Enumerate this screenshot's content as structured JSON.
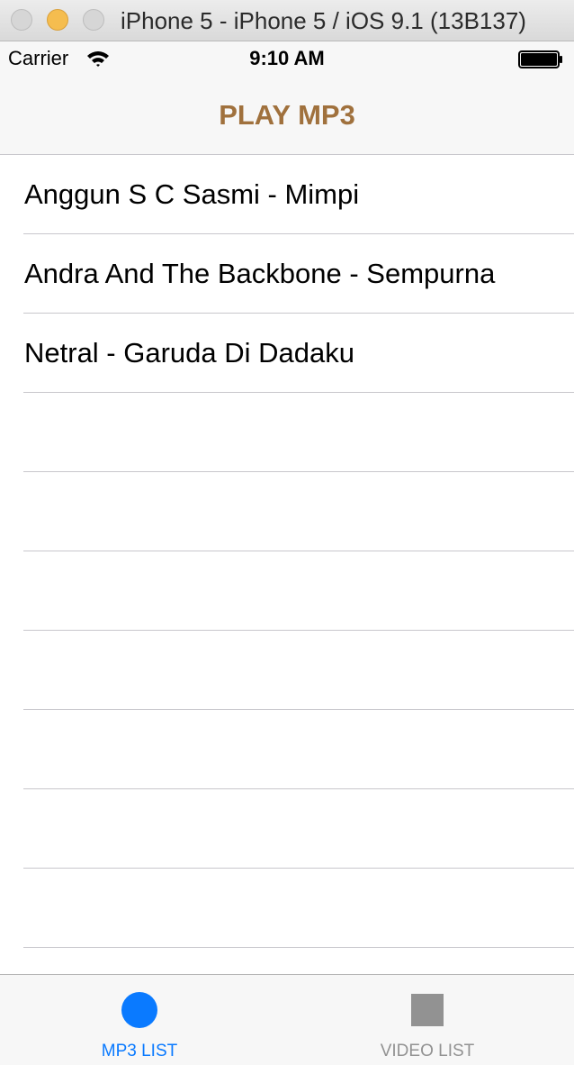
{
  "window": {
    "title": "iPhone 5 - iPhone 5 / iOS 9.1 (13B137)"
  },
  "status_bar": {
    "carrier": "Carrier",
    "time": "9:10 AM",
    "icons": [
      "wifi-icon",
      "battery-icon"
    ]
  },
  "nav": {
    "title": "PLAY MP3",
    "title_color": "#a0713d"
  },
  "list": {
    "items": [
      "Anggun S C Sasmi - Mimpi",
      "Andra And The Backbone - Sempurna",
      "Netral - Garuda Di Dadaku",
      "",
      "",
      "",
      "",
      "",
      "",
      "",
      ""
    ]
  },
  "tabs": [
    {
      "label": "MP3 LIST",
      "icon": "circle-icon",
      "selected": true,
      "color": "#0a7aff"
    },
    {
      "label": "VIDEO LIST",
      "icon": "square-icon",
      "selected": false,
      "color": "#929292"
    }
  ]
}
